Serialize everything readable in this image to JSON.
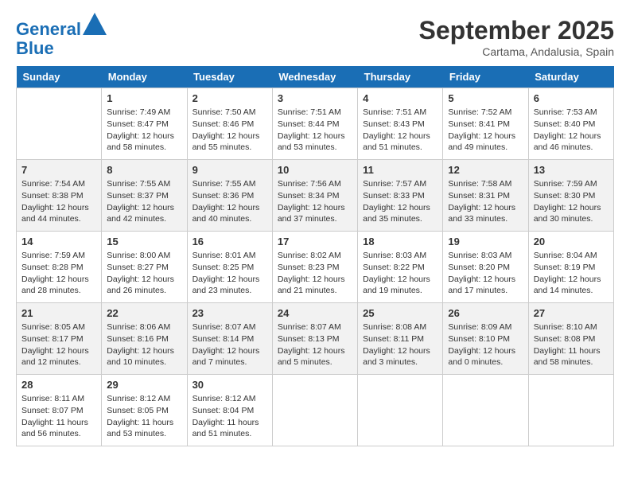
{
  "header": {
    "logo_line1": "General",
    "logo_line2": "Blue",
    "month_title": "September 2025",
    "location": "Cartama, Andalusia, Spain"
  },
  "days_of_week": [
    "Sunday",
    "Monday",
    "Tuesday",
    "Wednesday",
    "Thursday",
    "Friday",
    "Saturday"
  ],
  "weeks": [
    [
      {
        "day": "",
        "sunrise": "",
        "sunset": "",
        "daylight": ""
      },
      {
        "day": "1",
        "sunrise": "7:49 AM",
        "sunset": "8:47 PM",
        "daylight": "12 hours and 58 minutes."
      },
      {
        "day": "2",
        "sunrise": "7:50 AM",
        "sunset": "8:46 PM",
        "daylight": "12 hours and 55 minutes."
      },
      {
        "day": "3",
        "sunrise": "7:51 AM",
        "sunset": "8:44 PM",
        "daylight": "12 hours and 53 minutes."
      },
      {
        "day": "4",
        "sunrise": "7:51 AM",
        "sunset": "8:43 PM",
        "daylight": "12 hours and 51 minutes."
      },
      {
        "day": "5",
        "sunrise": "7:52 AM",
        "sunset": "8:41 PM",
        "daylight": "12 hours and 49 minutes."
      },
      {
        "day": "6",
        "sunrise": "7:53 AM",
        "sunset": "8:40 PM",
        "daylight": "12 hours and 46 minutes."
      }
    ],
    [
      {
        "day": "7",
        "sunrise": "7:54 AM",
        "sunset": "8:38 PM",
        "daylight": "12 hours and 44 minutes."
      },
      {
        "day": "8",
        "sunrise": "7:55 AM",
        "sunset": "8:37 PM",
        "daylight": "12 hours and 42 minutes."
      },
      {
        "day": "9",
        "sunrise": "7:55 AM",
        "sunset": "8:36 PM",
        "daylight": "12 hours and 40 minutes."
      },
      {
        "day": "10",
        "sunrise": "7:56 AM",
        "sunset": "8:34 PM",
        "daylight": "12 hours and 37 minutes."
      },
      {
        "day": "11",
        "sunrise": "7:57 AM",
        "sunset": "8:33 PM",
        "daylight": "12 hours and 35 minutes."
      },
      {
        "day": "12",
        "sunrise": "7:58 AM",
        "sunset": "8:31 PM",
        "daylight": "12 hours and 33 minutes."
      },
      {
        "day": "13",
        "sunrise": "7:59 AM",
        "sunset": "8:30 PM",
        "daylight": "12 hours and 30 minutes."
      }
    ],
    [
      {
        "day": "14",
        "sunrise": "7:59 AM",
        "sunset": "8:28 PM",
        "daylight": "12 hours and 28 minutes."
      },
      {
        "day": "15",
        "sunrise": "8:00 AM",
        "sunset": "8:27 PM",
        "daylight": "12 hours and 26 minutes."
      },
      {
        "day": "16",
        "sunrise": "8:01 AM",
        "sunset": "8:25 PM",
        "daylight": "12 hours and 23 minutes."
      },
      {
        "day": "17",
        "sunrise": "8:02 AM",
        "sunset": "8:23 PM",
        "daylight": "12 hours and 21 minutes."
      },
      {
        "day": "18",
        "sunrise": "8:03 AM",
        "sunset": "8:22 PM",
        "daylight": "12 hours and 19 minutes."
      },
      {
        "day": "19",
        "sunrise": "8:03 AM",
        "sunset": "8:20 PM",
        "daylight": "12 hours and 17 minutes."
      },
      {
        "day": "20",
        "sunrise": "8:04 AM",
        "sunset": "8:19 PM",
        "daylight": "12 hours and 14 minutes."
      }
    ],
    [
      {
        "day": "21",
        "sunrise": "8:05 AM",
        "sunset": "8:17 PM",
        "daylight": "12 hours and 12 minutes."
      },
      {
        "day": "22",
        "sunrise": "8:06 AM",
        "sunset": "8:16 PM",
        "daylight": "12 hours and 10 minutes."
      },
      {
        "day": "23",
        "sunrise": "8:07 AM",
        "sunset": "8:14 PM",
        "daylight": "12 hours and 7 minutes."
      },
      {
        "day": "24",
        "sunrise": "8:07 AM",
        "sunset": "8:13 PM",
        "daylight": "12 hours and 5 minutes."
      },
      {
        "day": "25",
        "sunrise": "8:08 AM",
        "sunset": "8:11 PM",
        "daylight": "12 hours and 3 minutes."
      },
      {
        "day": "26",
        "sunrise": "8:09 AM",
        "sunset": "8:10 PM",
        "daylight": "12 hours and 0 minutes."
      },
      {
        "day": "27",
        "sunrise": "8:10 AM",
        "sunset": "8:08 PM",
        "daylight": "11 hours and 58 minutes."
      }
    ],
    [
      {
        "day": "28",
        "sunrise": "8:11 AM",
        "sunset": "8:07 PM",
        "daylight": "11 hours and 56 minutes."
      },
      {
        "day": "29",
        "sunrise": "8:12 AM",
        "sunset": "8:05 PM",
        "daylight": "11 hours and 53 minutes."
      },
      {
        "day": "30",
        "sunrise": "8:12 AM",
        "sunset": "8:04 PM",
        "daylight": "11 hours and 51 minutes."
      },
      {
        "day": "",
        "sunrise": "",
        "sunset": "",
        "daylight": ""
      },
      {
        "day": "",
        "sunrise": "",
        "sunset": "",
        "daylight": ""
      },
      {
        "day": "",
        "sunrise": "",
        "sunset": "",
        "daylight": ""
      },
      {
        "day": "",
        "sunrise": "",
        "sunset": "",
        "daylight": ""
      }
    ]
  ]
}
